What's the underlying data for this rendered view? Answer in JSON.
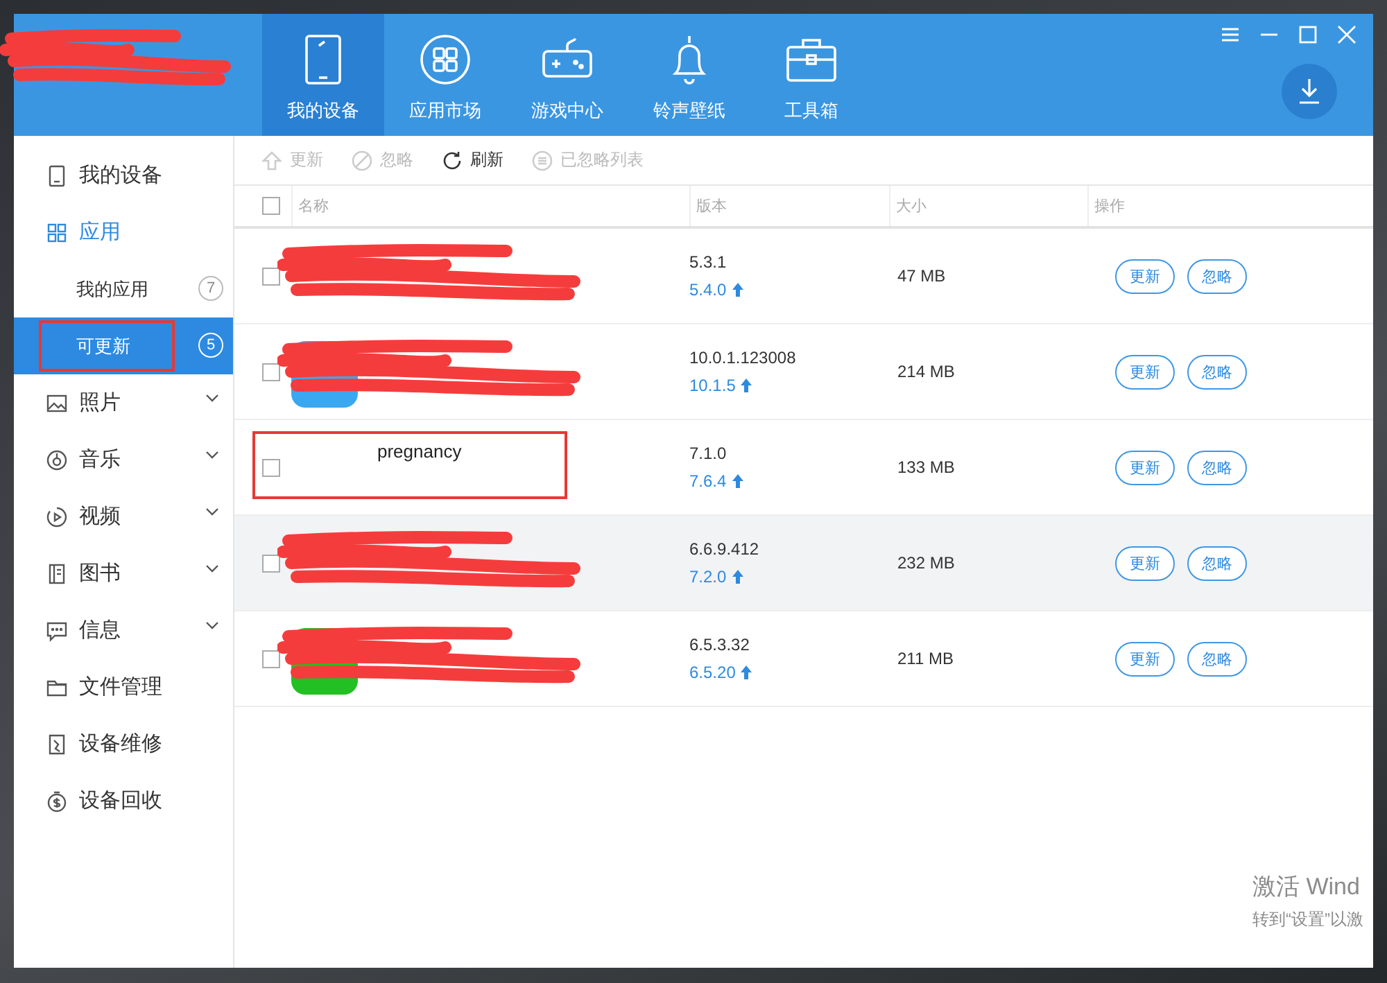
{
  "nav_tabs": [
    {
      "label": "我的设备",
      "selected": true
    },
    {
      "label": "应用市场",
      "selected": false
    },
    {
      "label": "游戏中心",
      "selected": false
    },
    {
      "label": "铃声壁纸",
      "selected": false
    },
    {
      "label": "工具箱",
      "selected": false
    }
  ],
  "sidebar": {
    "items": [
      {
        "label": "我的设备"
      },
      {
        "label": "应用",
        "expanded": true,
        "children": [
          {
            "label": "我的应用",
            "count": "7",
            "selected": false,
            "highlighted": false
          },
          {
            "label": "可更新",
            "count": "5",
            "selected": true,
            "highlighted": true
          }
        ]
      },
      {
        "label": "照片",
        "expanded": false
      },
      {
        "label": "音乐",
        "expanded": false
      },
      {
        "label": "视频",
        "expanded": false
      },
      {
        "label": "图书",
        "expanded": false
      },
      {
        "label": "信息",
        "expanded": false
      },
      {
        "label": "文件管理"
      },
      {
        "label": "设备维修"
      },
      {
        "label": "设备回收"
      }
    ]
  },
  "toolbar": [
    {
      "label": "更新",
      "disabled": true
    },
    {
      "label": "忽略",
      "disabled": true
    },
    {
      "label": "刷新",
      "disabled": false
    },
    {
      "label": "已忽略列表",
      "disabled": true
    }
  ],
  "table": {
    "select_all": false,
    "columns": [
      "名称",
      "版本",
      "大小",
      "操作"
    ],
    "rows": [
      {
        "checked": false,
        "redacted": true,
        "highlighted": false,
        "hovered": false,
        "version": "5.3.1",
        "latest": "5.4.0",
        "size": "47 MB",
        "actions": [
          "更新",
          "忽略"
        ]
      },
      {
        "checked": false,
        "redacted": true,
        "highlighted": false,
        "hovered": false,
        "color": "#3aa8f0",
        "version": "10.0.1.123008",
        "latest": "10.1.5",
        "size": "214 MB",
        "actions": [
          "更新",
          "忽略"
        ]
      },
      {
        "checked": false,
        "redacted": false,
        "highlighted": true,
        "hovered": false,
        "name": "pregnancy",
        "version": "7.1.0",
        "latest": "7.6.4",
        "size": "133 MB",
        "actions": [
          "更新",
          "忽略"
        ]
      },
      {
        "checked": false,
        "redacted": true,
        "highlighted": false,
        "hovered": true,
        "version": "6.6.9.412",
        "latest": "7.2.0",
        "size": "232 MB",
        "actions": [
          "更新",
          "忽略"
        ]
      },
      {
        "checked": false,
        "redacted": true,
        "highlighted": false,
        "hovered": false,
        "color": "#22c022",
        "version": "6.5.3.32",
        "latest": "6.5.20",
        "size": "211 MB",
        "actions": [
          "更新",
          "忽略"
        ]
      }
    ]
  },
  "activation_notice": {
    "title": "激活 Wind",
    "hint": "转到“设置”以激"
  }
}
